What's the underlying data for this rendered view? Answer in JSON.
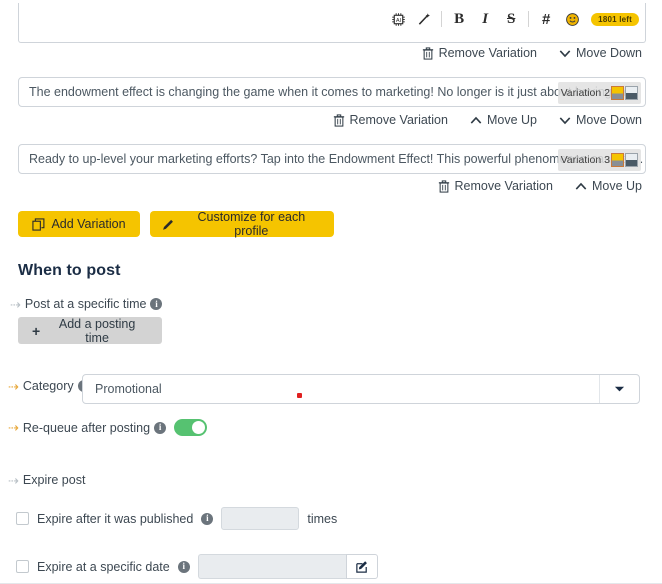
{
  "editor": {
    "toolbar": {
      "ai_icon": "ai-chip-icon",
      "magic_icon": "magic-wand-icon",
      "bold_label": "B",
      "italic_label": "I",
      "strike_label": "S",
      "hashtag_label": "#",
      "emoji_icon": "emoji-smiley-icon",
      "char_count": "1801 left",
      "badge_color": "#f5c400"
    }
  },
  "variations": [
    {
      "actions": [
        "Remove Variation",
        "Move Down"
      ],
      "show_move_up": false,
      "show_move_down": true
    },
    {
      "text": "The endowment effect is changing the game when it comes to marketing! No longer is it just about having the righ...",
      "tag": "Variation 2",
      "actions": [
        "Remove Variation",
        "Move Up",
        "Move Down"
      ],
      "show_move_up": true,
      "show_move_down": true
    },
    {
      "text": "Ready to up-level your marketing efforts? Tap into the Endowment Effect! This powerful phenomenon can help yo...",
      "tag": "Variation 3",
      "actions": [
        "Remove Variation",
        "Move Up"
      ],
      "show_move_up": true,
      "show_move_down": false
    }
  ],
  "labels": {
    "remove_variation": "Remove Variation",
    "move_up": "Move Up",
    "move_down": "Move Down"
  },
  "buttons": {
    "add_variation": "Add Variation",
    "customize_profile": "Customize for each profile",
    "add_posting_time": "Add a posting time"
  },
  "when_to_post": {
    "heading": "When to post",
    "post_specific_time_label": "Post at a specific time"
  },
  "category": {
    "label": "Category",
    "value": "Promotional",
    "options": [
      "Promotional"
    ]
  },
  "requeue": {
    "label": "Re-queue after posting",
    "enabled": true,
    "on_color": "#56c271"
  },
  "expire": {
    "heading": "Expire post",
    "published_label": "Expire after it was published",
    "published_suffix": "times",
    "published_value": "",
    "published_checked": false,
    "date_label": "Expire at a specific date",
    "date_value": "",
    "date_checked": false
  },
  "colors": {
    "accent_yellow": "#f5c400",
    "arrow_orange": "#e8a83c",
    "heading_navy": "#1b2d45",
    "toggle_green": "#56c271",
    "red_dot": "#e02020"
  }
}
